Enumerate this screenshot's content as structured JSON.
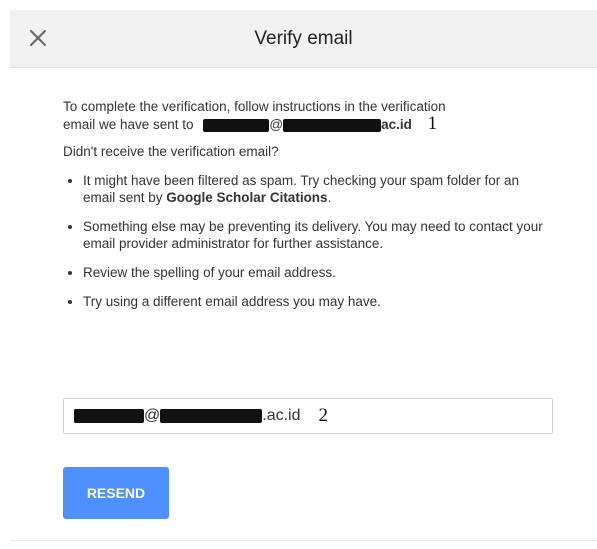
{
  "dialog": {
    "title": "Verify email",
    "close_icon": "close-icon"
  },
  "message": {
    "intro_part1": "To complete the verification, follow instructions in the verification",
    "intro_part2": "email we have sent to",
    "email_visible_suffix": "ac.id",
    "email_symbol": "@",
    "annotation_1": "1",
    "not_received": "Didn't receive the verification email?"
  },
  "bullets": [
    {
      "text": "It might have been filtered as spam. Try checking your spam folder for an email sent by ",
      "bold": "Google Scholar Citations",
      "tail": "."
    },
    {
      "text": "Something else may be preventing its delivery. You may need to contact your email provider administrator for further assistance."
    },
    {
      "text": "Review the spelling of your email address."
    },
    {
      "text": "Try using a different email address you may have."
    }
  ],
  "email_input": {
    "symbol": "@",
    "visible_suffix": ".ac.id",
    "annotation_2": "2"
  },
  "actions": {
    "resend_label": "RESEND"
  },
  "colors": {
    "header_bg": "#f1f1f1",
    "button_bg": "#4d90fe",
    "redaction": "#111111"
  }
}
